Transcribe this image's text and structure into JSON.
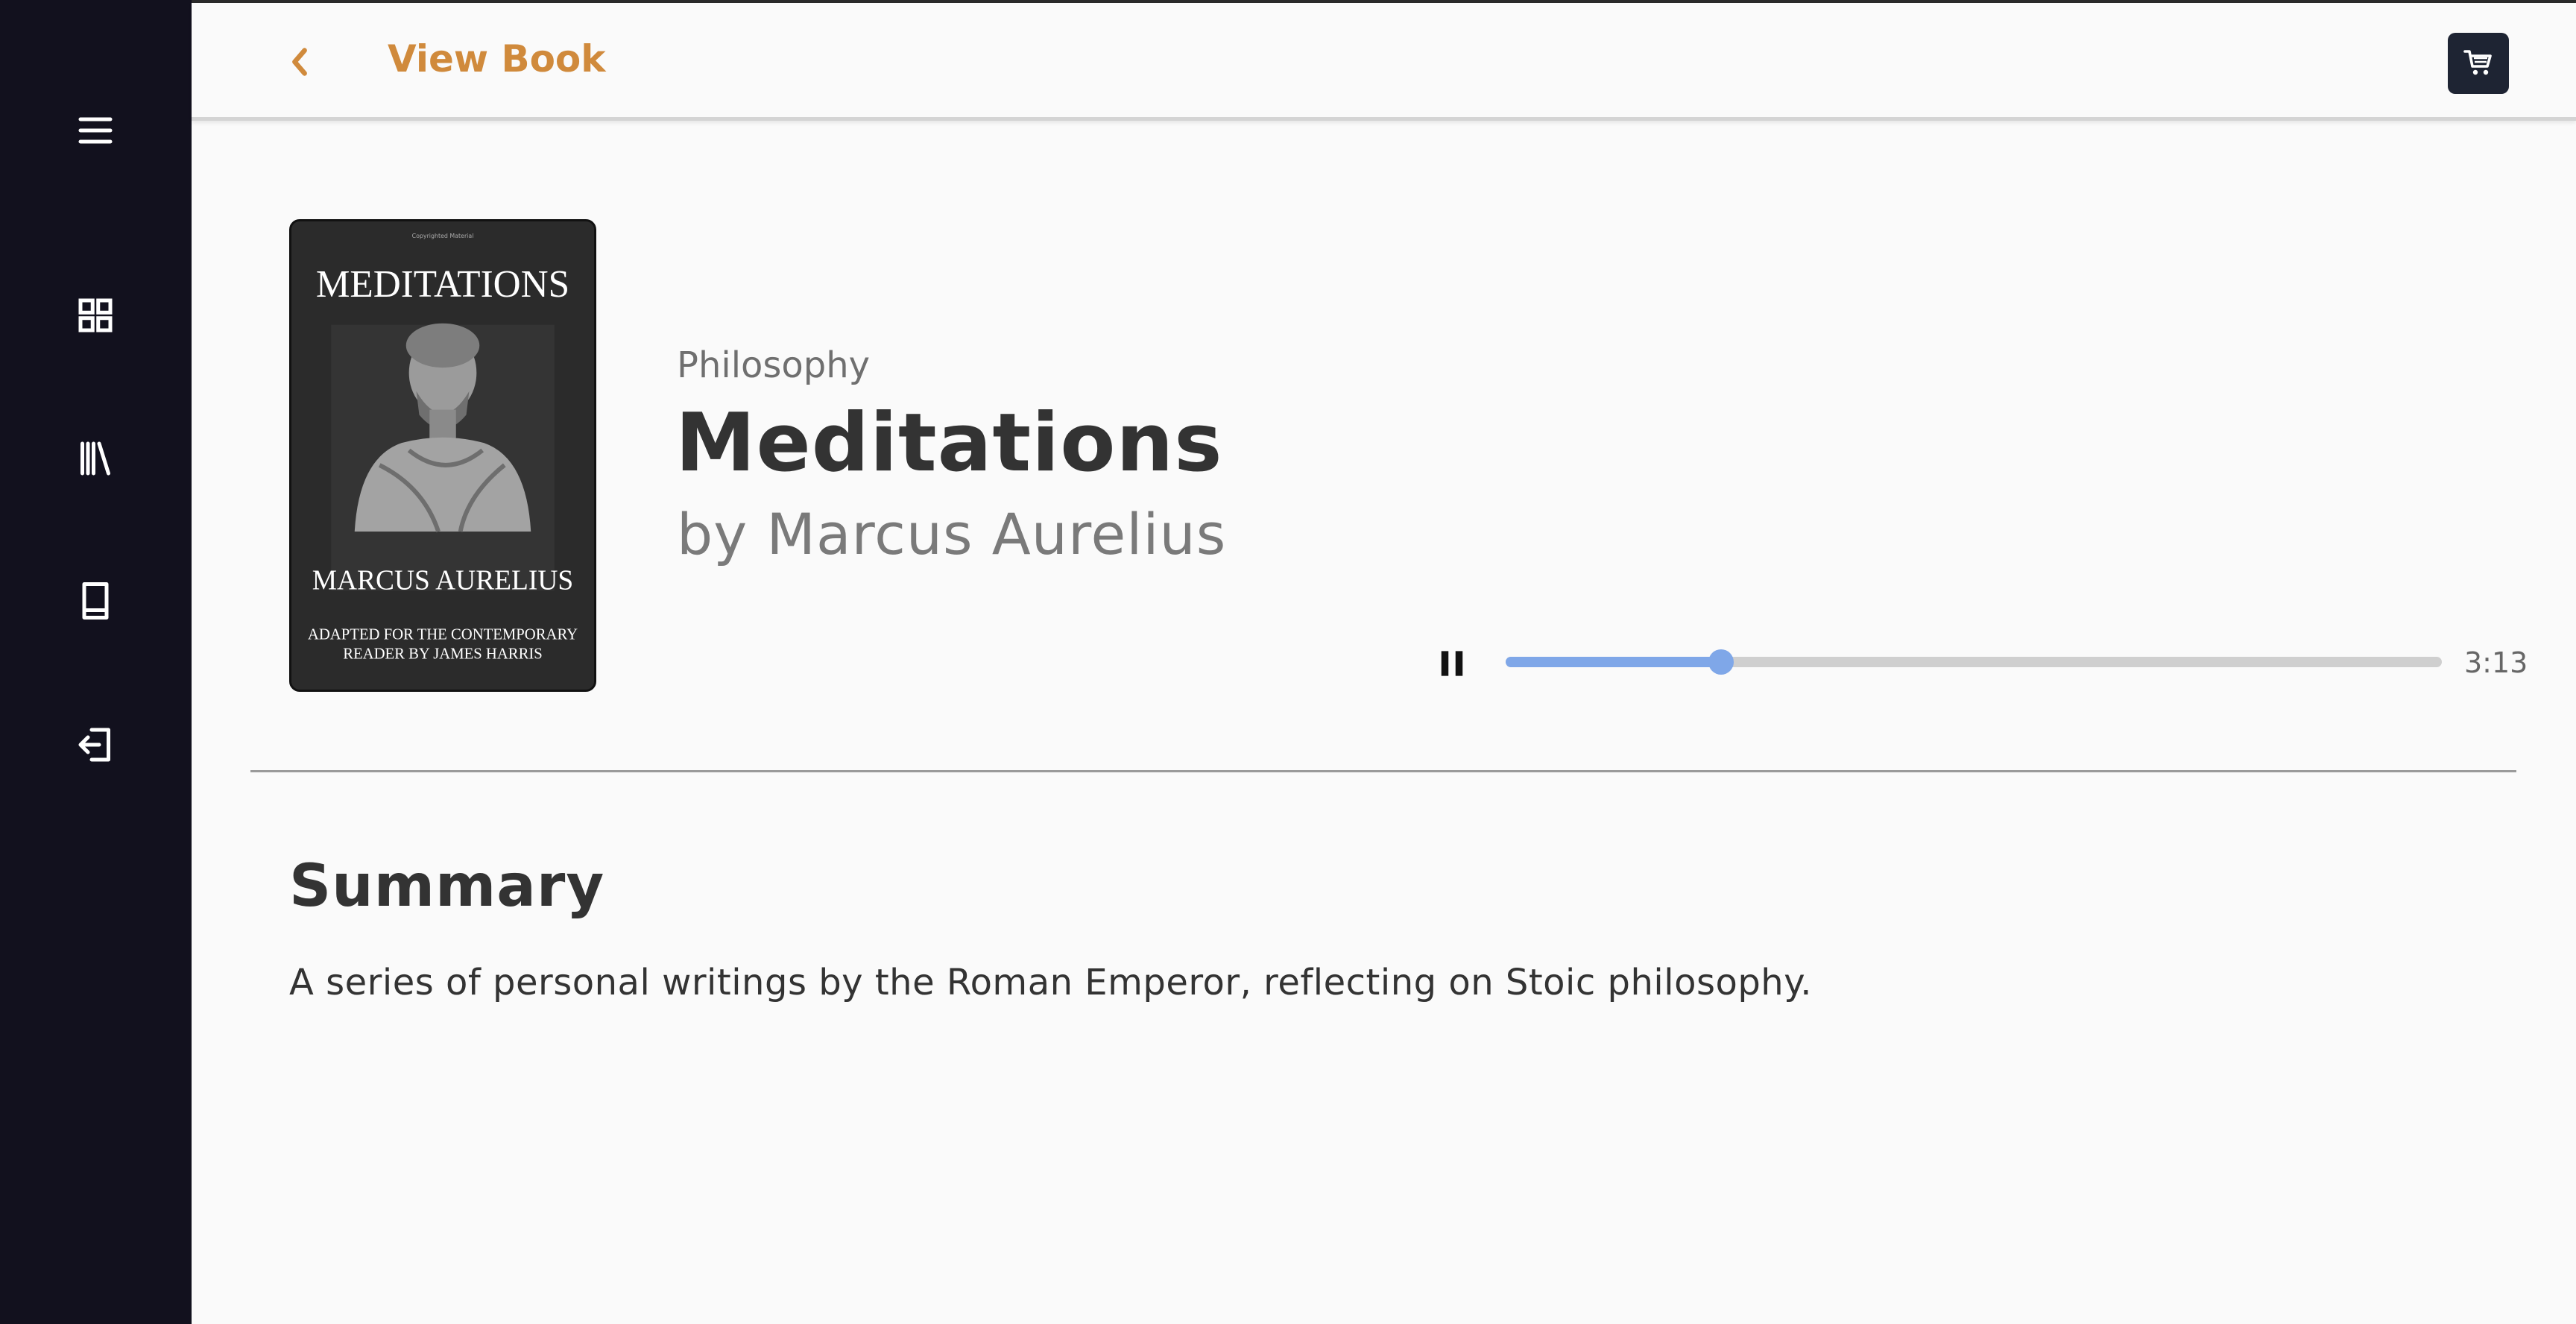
{
  "header": {
    "title": "View Book",
    "accent_color": "#d08a3c",
    "back_icon": "chevron-left-icon",
    "cart_icon": "cart-icon"
  },
  "sidebar": {
    "background": "#12111e",
    "items": [
      {
        "icon": "menu-icon"
      },
      {
        "icon": "dashboard-grid-icon"
      },
      {
        "icon": "library-icon"
      },
      {
        "icon": "book-icon"
      },
      {
        "icon": "logout-icon"
      }
    ]
  },
  "book": {
    "genre": "Philosophy",
    "title": "Meditations",
    "author": "by Marcus Aurelius",
    "cover": {
      "top_text": "MEDITATIONS",
      "author_text": "MARCUS AURELIUS",
      "tagline_line1": "ADAPTED FOR THE CONTEMPORARY",
      "tagline_line2": "READER BY JAMES HARRIS",
      "small_text": "Copyrighted Material"
    }
  },
  "player": {
    "state_icon": "pause-icon",
    "progress": 0.23,
    "time": "3:13",
    "progress_color": "#7fa7e8"
  },
  "summary": {
    "heading": "Summary",
    "text": "A series of personal writings by the Roman Emperor, reflecting on Stoic philosophy."
  }
}
